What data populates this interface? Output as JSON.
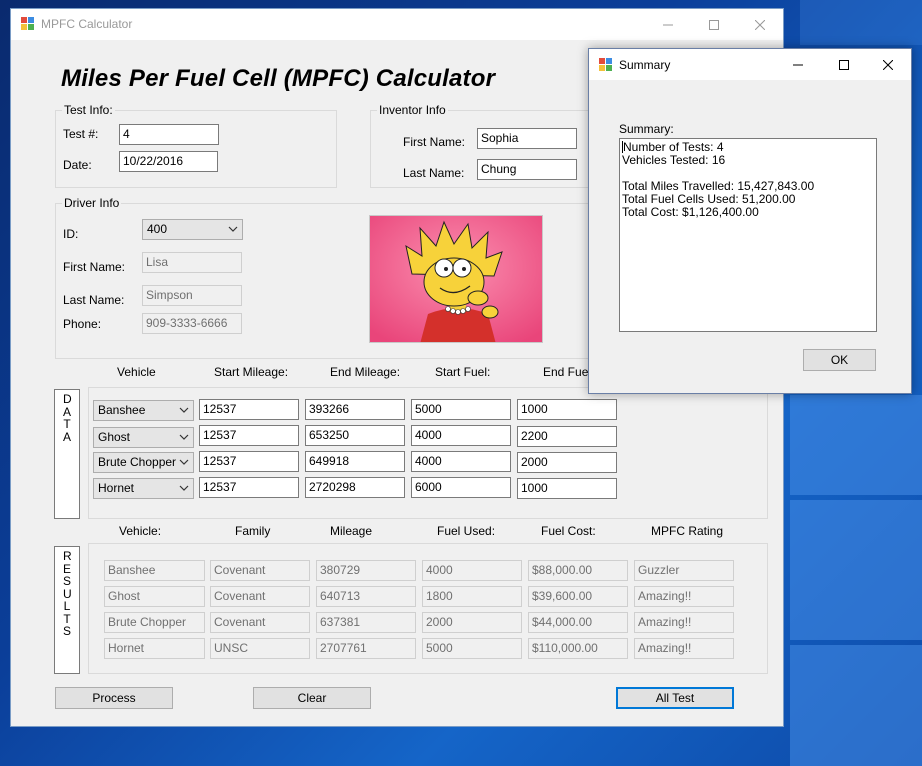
{
  "main_window": {
    "title": "MPFC Calculator",
    "heading": "Miles Per Fuel Cell (MPFC) Calculator",
    "test_info": {
      "group_label": "Test Info:",
      "test_num_label": "Test #:",
      "test_num_value": "4",
      "date_label": "Date:",
      "date_value": "10/22/2016"
    },
    "inventor_info": {
      "group_label": "Inventor Info",
      "first_name_label": "First Name:",
      "first_name_value": "Sophia",
      "last_name_label": "Last Name:",
      "last_name_value": "Chung"
    },
    "driver_info": {
      "group_label": "Driver Info",
      "id_label": "ID:",
      "id_value": "400",
      "first_name_label": "First Name:",
      "first_name_value": "Lisa",
      "last_name_label": "Last Name:",
      "last_name_value": "Simpson",
      "phone_label": "Phone:",
      "phone_value": "909-3333-6666"
    },
    "data_section": {
      "side_label": "DATA",
      "headers": [
        "Vehicle",
        "Start Mileage:",
        "End Mileage:",
        "Start Fuel:",
        "End Fuel:"
      ],
      "rows": [
        {
          "vehicle": "Banshee",
          "start_mileage": "12537",
          "end_mileage": "393266",
          "start_fuel": "5000",
          "end_fuel": "1000"
        },
        {
          "vehicle": "Ghost",
          "start_mileage": "12537",
          "end_mileage": "653250",
          "start_fuel": "4000",
          "end_fuel": "2200"
        },
        {
          "vehicle": "Brute Chopper",
          "start_mileage": "12537",
          "end_mileage": "649918",
          "start_fuel": "4000",
          "end_fuel": "2000"
        },
        {
          "vehicle": "Hornet",
          "start_mileage": "12537",
          "end_mileage": "2720298",
          "start_fuel": "6000",
          "end_fuel": "1000"
        }
      ]
    },
    "results_section": {
      "side_label": "RESULTS",
      "headers": [
        "Vehicle:",
        "Family",
        "Mileage",
        "Fuel Used:",
        "Fuel Cost:",
        "MPFC Rating"
      ],
      "rows": [
        {
          "vehicle": "Banshee",
          "family": "Covenant",
          "mileage": "380729",
          "fuel_used": "4000",
          "fuel_cost": "$88,000.00",
          "rating": "Guzzler"
        },
        {
          "vehicle": "Ghost",
          "family": "Covenant",
          "mileage": "640713",
          "fuel_used": "1800",
          "fuel_cost": "$39,600.00",
          "rating": "Amazing!!"
        },
        {
          "vehicle": "Brute Chopper",
          "family": "Covenant",
          "mileage": "637381",
          "fuel_used": "2000",
          "fuel_cost": "$44,000.00",
          "rating": "Amazing!!"
        },
        {
          "vehicle": "Hornet",
          "family": "UNSC",
          "mileage": "2707761",
          "fuel_used": "5000",
          "fuel_cost": "$110,000.00",
          "rating": "Amazing!!"
        }
      ]
    },
    "buttons": {
      "process": "Process",
      "clear": "Clear",
      "all_test": "All Test"
    }
  },
  "summary_dialog": {
    "title": "Summary",
    "label": "Summary:",
    "lines": [
      "Number of Tests: 4",
      "Vehicles Tested: 16",
      "",
      "Total Miles Travelled: 15,427,843.00",
      "Total Fuel Cells Used: 51,200.00",
      "Total Cost: $1,126,400.00"
    ],
    "ok_button": "OK"
  },
  "icons": {
    "app": "windows-forms-app-icon",
    "minimize": "minimize-icon",
    "maximize": "maximize-icon",
    "close": "close-icon",
    "dropdown": "chevron-down-icon"
  },
  "colors": {
    "accent": "#0078d7",
    "desktop": "#0b3f9a"
  }
}
